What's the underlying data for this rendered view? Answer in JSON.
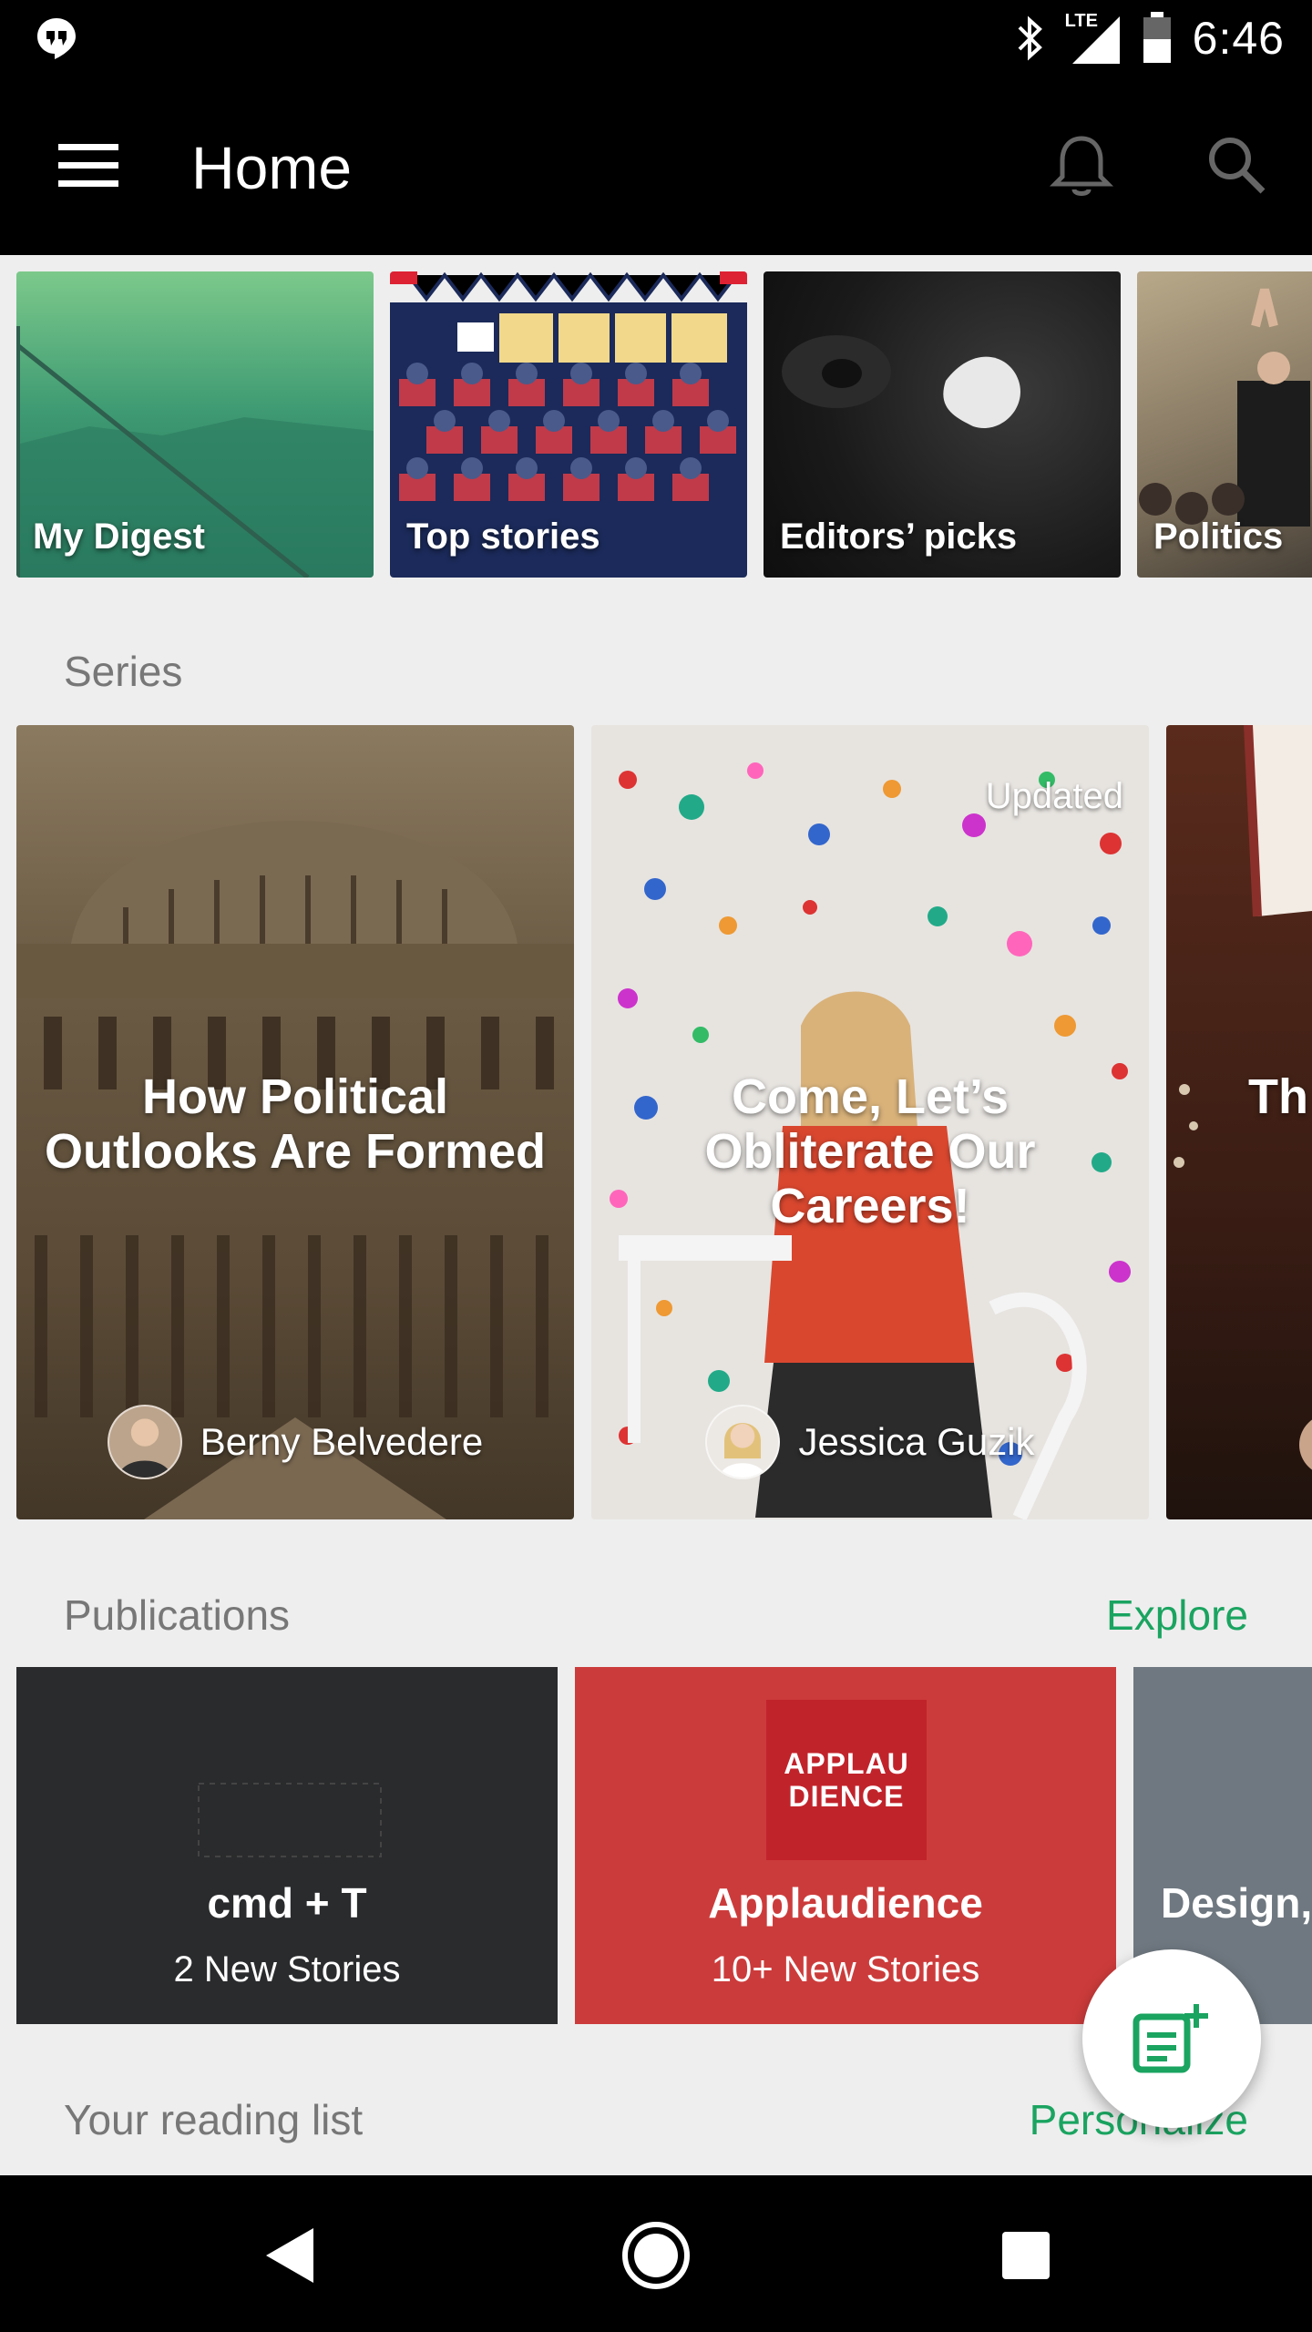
{
  "status": {
    "time": "6:46",
    "network": "LTE"
  },
  "app_bar": {
    "title": "Home"
  },
  "topics": [
    {
      "label": "My Digest"
    },
    {
      "label": "Top stories"
    },
    {
      "label": "Editors’ picks"
    },
    {
      "label": "Politics"
    }
  ],
  "series": {
    "title": "Series",
    "items": [
      {
        "title": "How Political Outlooks Are Formed",
        "author": "Berny Belvedere"
      },
      {
        "title": "Come, Let’s Obliterate Our Careers!",
        "author": "Jessica Guzik",
        "badge": "Updated"
      },
      {
        "title": "Th"
      }
    ]
  },
  "publications": {
    "title": "Publications",
    "link": "Explore",
    "items": [
      {
        "name": "cmd + T",
        "subtitle": "2 New Stories"
      },
      {
        "name": "Applaudience",
        "subtitle": "10+ New Stories",
        "logo_text": "APPLAU DIENCE"
      },
      {
        "name": "Design,"
      }
    ]
  },
  "reading_list": {
    "title": "Your reading list",
    "link": "Personalize"
  },
  "colors": {
    "accent": "#1aa460",
    "app_bar": "#000000",
    "background": "#eeeeee"
  }
}
